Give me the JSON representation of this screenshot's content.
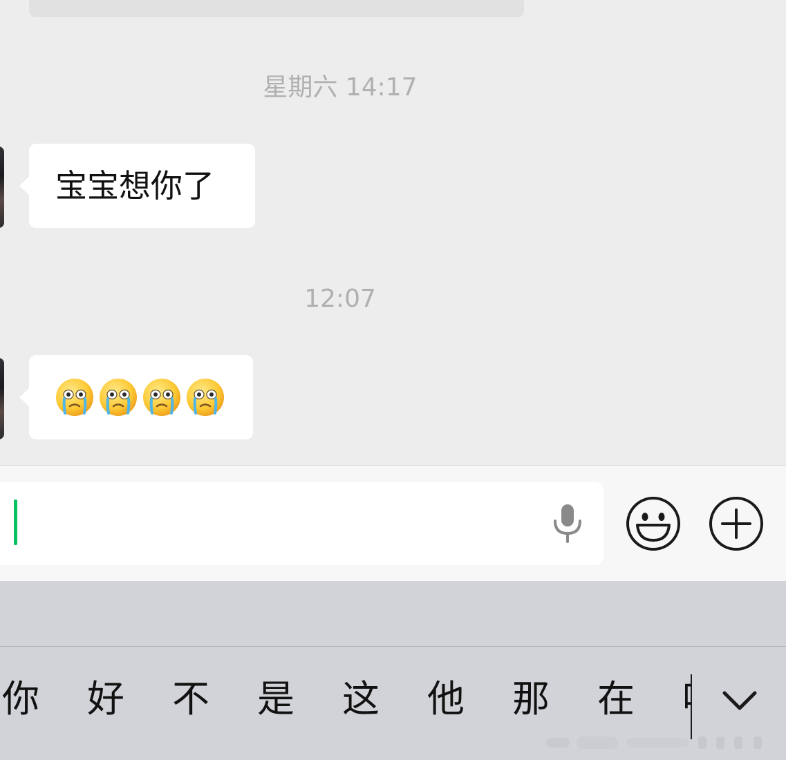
{
  "chat": {
    "timestamps": [
      "星期六 14:17",
      "12:07"
    ],
    "messages": [
      {
        "sender": "other",
        "text": "宝宝想你了"
      },
      {
        "sender": "other",
        "emoji": "crying-face",
        "count": 4
      }
    ]
  },
  "input_bar": {
    "text_value": "",
    "icons": [
      "microphone-icon",
      "emoji-icon",
      "plus-icon"
    ]
  },
  "keyboard": {
    "candidates": [
      "你",
      "好",
      "不",
      "是",
      "这",
      "他",
      "那",
      "在",
      "吗"
    ],
    "collapse_icon": "chevron-down-icon"
  },
  "colors": {
    "chat_background": "#ededed",
    "bubble": "#ffffff",
    "timestamp_text": "#b0b0b0",
    "caret": "#07c160",
    "keyboard_background": "#d1d3d8"
  }
}
